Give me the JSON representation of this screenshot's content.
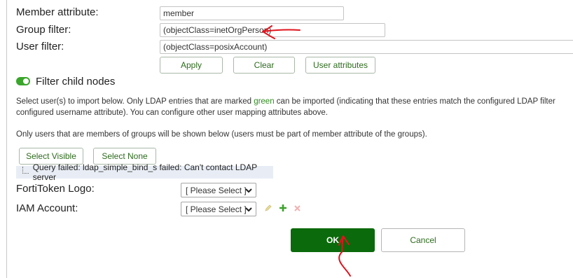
{
  "form": {
    "member_attribute": {
      "label": "Member attribute:",
      "value": "member"
    },
    "group_filter": {
      "label": "Group filter:",
      "value": "(objectClass=inetOrgPerson)"
    },
    "user_filter": {
      "label": "User filter:",
      "value": "(objectClass=posixAccount)"
    },
    "buttons": {
      "apply": "Apply",
      "clear": "Clear",
      "user_attributes": "User attributes"
    },
    "filter_child_nodes": {
      "label": "Filter child nodes",
      "enabled": true
    }
  },
  "info": {
    "line1_pre": "Select user(s) to import below. Only LDAP entries that are marked ",
    "line1_green": "green",
    "line1_post": " can be imported (indicating that these entries match the configured LDAP filter",
    "line2": "configured username attribute). You can configure other user mapping attributes above.",
    "line3": "Only users that are members of groups will be shown below (users must be part of member attribute of the groups)."
  },
  "selection": {
    "select_visible": "Select Visible",
    "select_none": "Select None"
  },
  "error": "Query failed: ldap_simple_bind_s failed: Can't contact LDAP server",
  "fortitoken": {
    "label": "FortiToken Logo:",
    "value": "[ Please Select ]"
  },
  "iam": {
    "label": "IAM Account:",
    "value": "[ Please Select ]"
  },
  "actions": {
    "ok": "OK",
    "cancel": "Cancel"
  },
  "colors": {
    "accent_green": "#0b6a0b",
    "toggle_green": "#3aa62b",
    "annotation_red": "#e0141e"
  }
}
